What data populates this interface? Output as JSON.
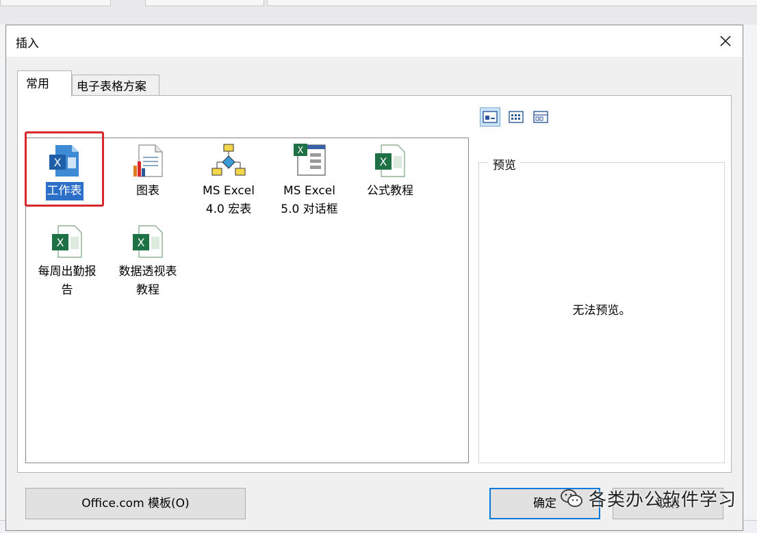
{
  "dialog": {
    "title": "插入"
  },
  "tabs": [
    {
      "label": "常用",
      "active": true
    },
    {
      "label": "电子表格方案",
      "active": false
    }
  ],
  "view_modes": [
    {
      "icon": "large-icons-view-icon",
      "active": true
    },
    {
      "icon": "list-view-icon",
      "active": false
    },
    {
      "icon": "details-view-icon",
      "active": false
    }
  ],
  "items": [
    {
      "label": "工作表",
      "icon": "excel-workbook-icon",
      "selected": true
    },
    {
      "label": "图表",
      "icon": "chart-document-icon",
      "selected": false
    },
    {
      "label": "MS Excel\n4.0 宏表",
      "icon": "macro-sheet-icon",
      "selected": false
    },
    {
      "label": "MS Excel\n5.0 对话框",
      "icon": "dialog-sheet-icon",
      "selected": false
    },
    {
      "label": "公式教程",
      "icon": "excel-template-icon",
      "selected": false
    },
    {
      "label": "每周出勤报\n告",
      "icon": "excel-template-icon",
      "selected": false
    },
    {
      "label": "数据透视表\n教程",
      "icon": "excel-template-icon",
      "selected": false
    }
  ],
  "preview": {
    "legend": "预览",
    "text": "无法预览。"
  },
  "buttons": {
    "templates": "Office.com 模板(O)",
    "ok": "确定",
    "cancel": "取消"
  },
  "watermark": {
    "text": "各类办公软件学习"
  },
  "colors": {
    "accent": "#0078d7",
    "selection": "#2c6fc9",
    "highlight_box": "#d9272e",
    "excel_green": "#1e7145",
    "excel_blue": "#2b579a"
  }
}
